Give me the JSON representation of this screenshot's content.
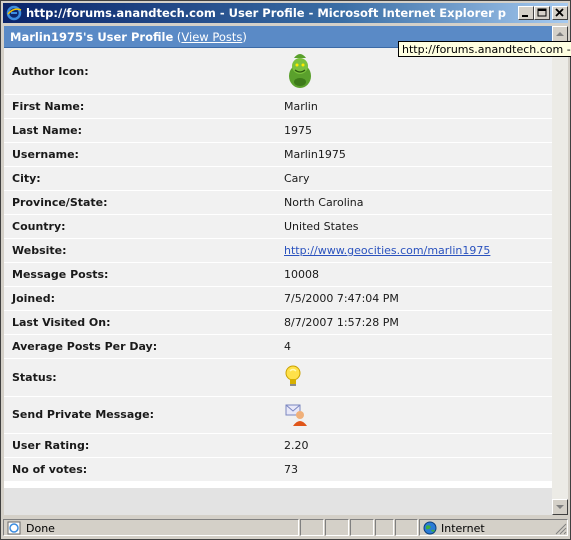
{
  "window": {
    "title": "http://forums.anandtech.com - User Profile - Microsoft Internet Explorer provided by..."
  },
  "profile": {
    "title": "Marlin1975's User Profile",
    "link_open": " (",
    "view_posts_label": "View Posts",
    "link_close": ")"
  },
  "tooltip": {
    "text": "http://forums.anandtech.com - Use"
  },
  "fields": [
    {
      "label": "Author Icon:",
      "value": "",
      "icon": "grinch-avatar-icon"
    },
    {
      "label": "First Name:",
      "value": "Marlin"
    },
    {
      "label": "Last Name:",
      "value": "1975"
    },
    {
      "label": "Username:",
      "value": "Marlin1975"
    },
    {
      "label": "City:",
      "value": "Cary"
    },
    {
      "label": "Province/State:",
      "value": "North Carolina"
    },
    {
      "label": "Country:",
      "value": "United States"
    },
    {
      "label": "Website:",
      "value": "http://www.geocities.com/marlin1975",
      "link": true
    },
    {
      "label": "Message Posts:",
      "value": "10008"
    },
    {
      "label": "Joined:",
      "value": "7/5/2000 7:47:04 PM"
    },
    {
      "label": "Last Visited On:",
      "value": "8/7/2007 1:57:28 PM"
    },
    {
      "label": "Average Posts Per Day:",
      "value": "4"
    },
    {
      "label": "Status:",
      "value": "",
      "icon": "lightbulb-icon"
    },
    {
      "label": "Send Private Message:",
      "value": "",
      "icon": "send-message-icon"
    },
    {
      "label": "User Rating:",
      "value": "2.20"
    },
    {
      "label": "No of votes:",
      "value": "73"
    }
  ],
  "statusbar": {
    "status": "Done",
    "zone": "Internet"
  },
  "colors": {
    "title_gradient_start": "#0a246a",
    "header_bar": "#5a8ac6",
    "row_bg": "#f1f1f1",
    "link": "#2a52be"
  }
}
